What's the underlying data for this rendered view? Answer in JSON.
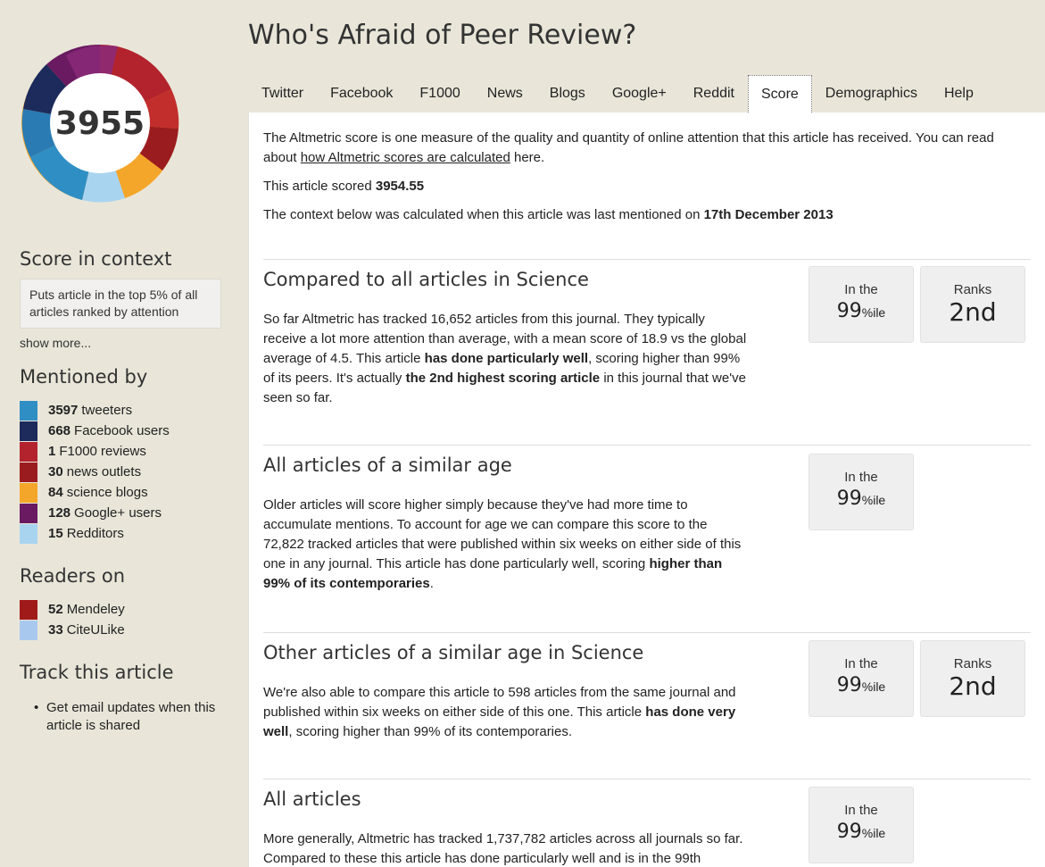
{
  "title": "Who's Afraid of Peer Review?",
  "score_badge": "3955",
  "colors": {
    "twitter": "#2f8fc4",
    "facebook": "#1c2a5c",
    "f1000": "#b3232d",
    "news": "#9b1c1f",
    "blogs": "#f4a62a",
    "googleplus": "#6a1a61",
    "reddit": "#a9d4f0",
    "mendeley": "#a01a1a",
    "citeulike": "#a9c8ee"
  },
  "sidebar": {
    "score_heading": "Score in context",
    "context_text": "Puts article in the top 5% of all articles ranked by attention",
    "show_more": "show more...",
    "mentioned_heading": "Mentioned by",
    "mentions": [
      {
        "count": "3597",
        "label": "tweeters",
        "color": "#2f8fc4"
      },
      {
        "count": "668",
        "label": "Facebook users",
        "color": "#1c2a5c"
      },
      {
        "count": "1",
        "label": "F1000 reviews",
        "color": "#b3232d"
      },
      {
        "count": "30",
        "label": "news outlets",
        "color": "#9b1c1f"
      },
      {
        "count": "84",
        "label": "science blogs",
        "color": "#f4a62a"
      },
      {
        "count": "128",
        "label": "Google+ users",
        "color": "#6a1a61"
      },
      {
        "count": "15",
        "label": "Redditors",
        "color": "#a9d4f0"
      }
    ],
    "readers_heading": "Readers on",
    "readers": [
      {
        "count": "52",
        "label": "Mendeley",
        "color": "#a01a1a"
      },
      {
        "count": "33",
        "label": "CiteULike",
        "color": "#a9c8ee"
      }
    ],
    "track_heading": "Track this article",
    "track_item": "Get email updates when this article is shared"
  },
  "tabs": [
    "Twitter",
    "Facebook",
    "F1000",
    "News",
    "Blogs",
    "Google+",
    "Reddit",
    "Score",
    "Demographics",
    "Help"
  ],
  "active_tab": "Score",
  "intro": {
    "p1_before": "The Altmetric score is one measure of the quality and quantity of online attention that this article has received. You can read about ",
    "p1_link": "how Altmetric scores are calculated",
    "p1_after": " here.",
    "p2_before": "This article scored ",
    "p2_score": "3954.55",
    "p3_before": "The context below was calculated when this article was last mentioned on ",
    "p3_date": "17th December 2013"
  },
  "stat_labels": {
    "in_the": "In the",
    "ranks": "Ranks",
    "pct": "99",
    "pct_suffix": "%ile",
    "rank": "2nd"
  },
  "sections": [
    {
      "heading": "Compared to all articles in Science",
      "t1": "So far Altmetric has tracked 16,652 articles from this journal. They typically receive a lot more attention than average, with a mean score of 18.9 vs the global average of 4.5. This article ",
      "b1": "has done particularly well",
      "t2": ", scoring higher than 99% of its peers. It's actually ",
      "b2": "the 2nd highest scoring article",
      "t3": " in this journal that we've seen so far."
    },
    {
      "heading": "All articles of a similar age",
      "t1": "Older articles will score higher simply because they've had more time to accumulate mentions. To account for age we can compare this score to the 72,822 tracked articles that were published within six weeks on either side of this one in any journal. This article has done particularly well, scoring ",
      "b1": "higher than 99% of its contemporaries",
      "t2": "."
    },
    {
      "heading": "Other articles of a similar age in Science",
      "t1": "We're also able to compare this article to 598 articles from the same journal and published within six weeks on either side of this one. This article ",
      "b1": "has done very well",
      "t2": ", scoring higher than 99% of its contemporaries."
    },
    {
      "heading": "All articles",
      "t1": "More generally, Altmetric has tracked 1,737,782 articles across all journals so far. Compared to these this article has done particularly well and is in the 99th"
    }
  ]
}
